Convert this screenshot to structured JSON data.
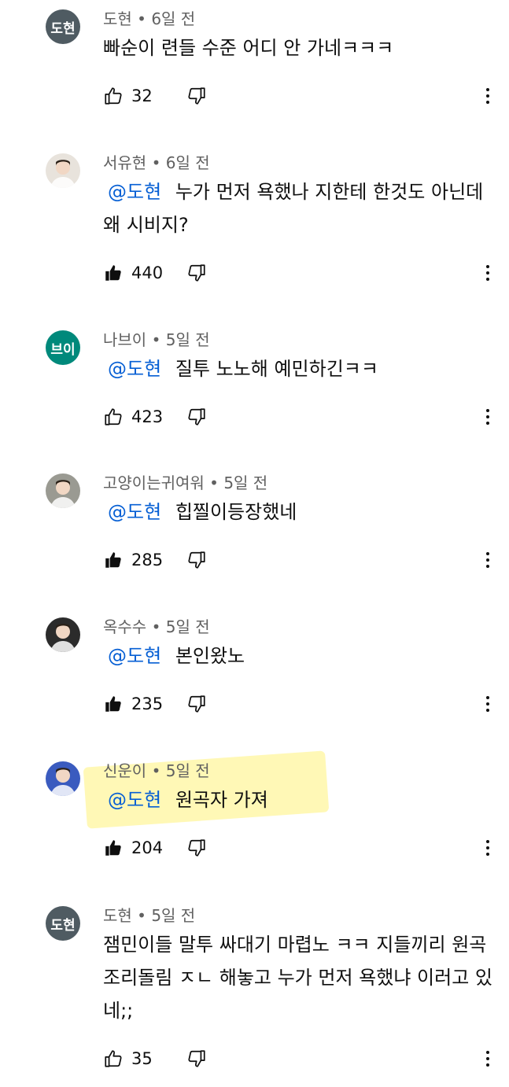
{
  "comments": [
    {
      "author": "도현",
      "time": "6일 전",
      "mention": "",
      "text": "빠순이 련들 수준 어디 안 가네ㅋㅋㅋ",
      "likes": "32",
      "liked": false,
      "avatar": {
        "type": "text",
        "label": "도현",
        "color": "#4f5b62"
      }
    },
    {
      "author": "서유현",
      "time": "6일 전",
      "mention": "@도현",
      "text": "누가 먼저 욕했나 지한테 한것도 아닌데 왜 시비지?",
      "likes": "440",
      "liked": true,
      "avatar": {
        "type": "photo",
        "label": "",
        "color": "#e8e3dc"
      }
    },
    {
      "author": "나브이",
      "time": "5일 전",
      "mention": "@도현",
      "text": "질투 노노해 예민하긴ㅋㅋ",
      "likes": "423",
      "liked": false,
      "avatar": {
        "type": "text",
        "label": "브이",
        "color": "#00897b"
      }
    },
    {
      "author": "고양이는귀여워",
      "time": "5일 전",
      "mention": "@도현",
      "text": "힙찔이등장했네",
      "likes": "285",
      "liked": true,
      "avatar": {
        "type": "photo",
        "label": "",
        "color": "#9a9a92"
      }
    },
    {
      "author": "옥수수",
      "time": "5일 전",
      "mention": "@도현",
      "text": "본인왔노",
      "likes": "235",
      "liked": true,
      "avatar": {
        "type": "photo",
        "label": "",
        "color": "#2b2b2b"
      }
    },
    {
      "author": "신운이",
      "time": "5일 전",
      "mention": "@도현",
      "text": "원곡자 가져",
      "likes": "204",
      "liked": true,
      "avatar": {
        "type": "photo",
        "label": "",
        "color": "#3a5bbf"
      }
    },
    {
      "author": "도현",
      "time": "5일 전",
      "mention": "",
      "text": "잼민이들 말투 싸대기 마렵노 ㅋㅋ 지들끼리 원곡 조리돌림 ㅈㄴ 해놓고 누가 먼저 욕했냐 이러고 있네;;",
      "likes": "35",
      "liked": false,
      "avatar": {
        "type": "text",
        "label": "도현",
        "color": "#4f5b62"
      }
    }
  ]
}
